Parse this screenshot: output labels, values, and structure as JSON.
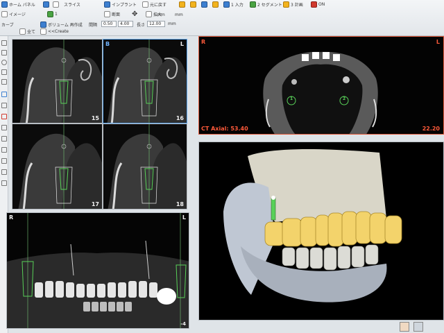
{
  "toolbar": {
    "row1": {
      "app_title": "ホーム パネル",
      "slice_label": "スライス",
      "implant_label": "インプラント",
      "undo_label": "元に戻す",
      "mode_1": "1 入力",
      "mode_2": "2 セグメント",
      "mode_3": "3 計画",
      "toggle": "ON"
    },
    "row2": {
      "image_label": "イメージ",
      "slice_count": "1",
      "cross_label": "断面",
      "zoom_label": "拡大",
      "unit_1": "mm",
      "unit_2": "mm"
    },
    "row3": {
      "curve_label": "カーブ",
      "all_label": "全て",
      "volume_label": "ボリューム 再作成",
      "recreate_label": "<<Create",
      "spacing_label": "間隔",
      "spacing_value": "0.50",
      "thickness_value": "4.00",
      "length_label": "長さ",
      "length_value": "12.00",
      "length_unit": "mm"
    }
  },
  "cross_sections": [
    {
      "number": "15",
      "side": "",
      "selected": false
    },
    {
      "number": "16",
      "side": "B",
      "selected": true
    },
    {
      "number": "17",
      "side": "",
      "selected": false
    },
    {
      "number": "18",
      "side": "",
      "selected": false
    }
  ],
  "cross_section_side_right": "L",
  "axial": {
    "left": "R",
    "right": "L",
    "label": "CT Axial: 53.40",
    "value": "22.20",
    "implant_ids": [
      "1",
      "2"
    ]
  },
  "panoramic": {
    "left": "R",
    "right": "L",
    "corner": "-4"
  },
  "colors": {
    "accent_blue": "#5da7ef",
    "accent_red": "#e05a3c",
    "crown_yellow": "#f3d36b",
    "implant_green": "#58d158"
  }
}
